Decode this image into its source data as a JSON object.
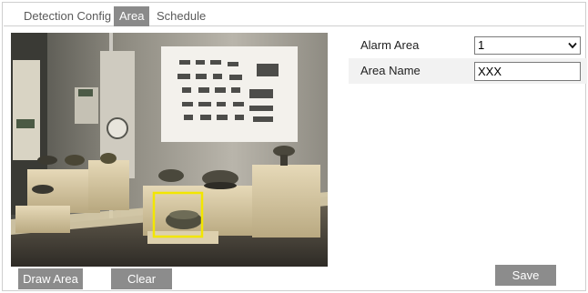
{
  "tabs": [
    {
      "label": "Detection Config",
      "active": false
    },
    {
      "label": "Area",
      "active": true
    },
    {
      "label": "Schedule",
      "active": false
    }
  ],
  "form": {
    "alarm_area": {
      "label": "Alarm Area",
      "value": "1"
    },
    "area_name": {
      "label": "Area Name",
      "value": "XXX"
    }
  },
  "buttons": {
    "draw_area": "Draw Area",
    "clear": "Clear",
    "save": "Save"
  },
  "colors": {
    "tab_active_bg": "#8a8a8a",
    "button_bg": "#8c8c8c",
    "detection_box": "#f2e600"
  },
  "icons": {
    "select_arrow": "chevron-down-icon"
  }
}
